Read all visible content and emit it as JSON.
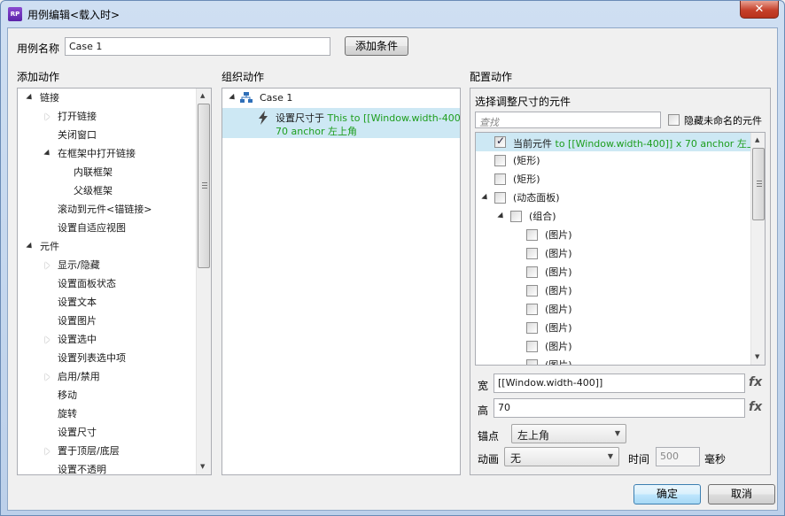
{
  "window": {
    "title": "用例编辑<载入时>",
    "app_icon": "RP",
    "close": "✕"
  },
  "case": {
    "name_label": "用例名称",
    "name_value": "Case 1",
    "add_condition": "添加条件"
  },
  "add_actions": {
    "header": "添加动作",
    "items": [
      "链接",
      "打开链接",
      "关闭窗口",
      "在框架中打开链接",
      "内联框架",
      "父级框架",
      "滚动到元件<锚链接>",
      "设置自适应视图",
      "元件",
      "显示/隐藏",
      "设置面板状态",
      "设置文本",
      "设置图片",
      "设置选中",
      "设置列表选中项",
      "启用/禁用",
      "移动",
      "旋转",
      "设置尺寸",
      "置于顶层/底层",
      "设置不透明"
    ]
  },
  "organize": {
    "header": "组织动作",
    "case_label": "Case 1",
    "action_prefix": "设置尺寸于",
    "action_detail_1": "This to [[Window.width-400]] x",
    "action_detail_2": "70 anchor 左上角"
  },
  "config": {
    "header": "配置动作",
    "select_title": "选择调整尺寸的元件",
    "search_placeholder": "查找",
    "hide_unnamed": "隐藏未命名的元件",
    "current_prefix": "当前元件",
    "current_detail": "to [[Window.width-400]] x 70 anchor 左上角",
    "items": [
      "(矩形)",
      "(矩形)",
      "(动态面板)",
      "(组合)",
      "(图片)",
      "(图片)",
      "(图片)",
      "(图片)",
      "(图片)",
      "(图片)",
      "(图片)",
      "(图片)"
    ],
    "width_label": "宽",
    "width_value": "[[Window.width-400]]",
    "height_label": "高",
    "height_value": "70",
    "fx": "fx",
    "anchor_label": "锚点",
    "anchor_value": "左上角",
    "anim_label": "动画",
    "anim_value": "无",
    "time_label": "时间",
    "time_value": "500",
    "ms_label": "毫秒"
  },
  "footer": {
    "ok": "确定",
    "cancel": "取消"
  }
}
